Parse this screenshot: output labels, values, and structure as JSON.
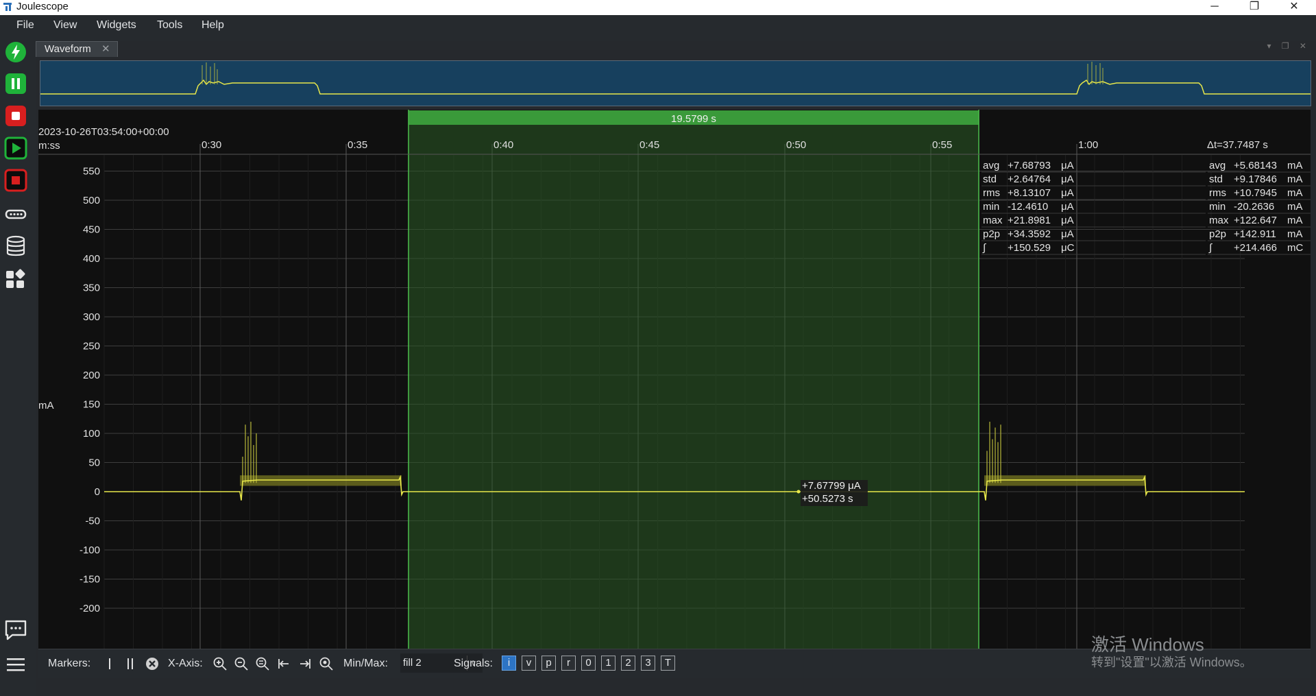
{
  "window": {
    "title": "Joulescope",
    "minimize": "─",
    "maximize": "❐",
    "close": "✕"
  },
  "menu": [
    "File",
    "View",
    "Widgets",
    "Tools",
    "Help"
  ],
  "sidebar_icons": [
    "lightning-icon",
    "pause-icon",
    "stop-icon",
    "play-icon",
    "record-stop-icon",
    "device-icon",
    "database-icon",
    "widgets-icon",
    "chat-icon",
    "menu-icon"
  ],
  "tab": {
    "label": "Waveform",
    "close": "✕"
  },
  "plot": {
    "timestamp": "2023-10-26T03:54:00+00:00",
    "x_format": "m:ss",
    "x_ticks": [
      "0:30",
      "0:35",
      "0:40",
      "0:45",
      "0:50",
      "0:55",
      "1:00"
    ],
    "y_label": "mA",
    "y_ticks": [
      "550",
      "500",
      "450",
      "400",
      "350",
      "300",
      "250",
      "200",
      "150",
      "100",
      "50",
      "0",
      "-50",
      "-100",
      "-150",
      "-200"
    ],
    "delta_t": "Δt=37.7487 s",
    "selection_width": "19.5799 s",
    "cursor_value": "+7.67799 μA",
    "cursor_time": "+50.5273 s",
    "trace_color": "#e8e84a",
    "selection_color": "#3a9a3a"
  },
  "stats_selection": [
    {
      "name": "avg",
      "value": "+7.68793",
      "unit": "μA"
    },
    {
      "name": "std",
      "value": "+2.64764",
      "unit": "μA"
    },
    {
      "name": "rms",
      "value": "+8.13107",
      "unit": "μA"
    },
    {
      "name": "min",
      "value": "-12.4610",
      "unit": "μA"
    },
    {
      "name": "max",
      "value": "+21.8981",
      "unit": "μA"
    },
    {
      "name": "p2p",
      "value": "+34.3592",
      "unit": "μA"
    },
    {
      "name": "∫",
      "value": "+150.529",
      "unit": "μC"
    }
  ],
  "stats_view": [
    {
      "name": "avg",
      "value": "+5.68143",
      "unit": "mA"
    },
    {
      "name": "std",
      "value": "+9.17846",
      "unit": "mA"
    },
    {
      "name": "rms",
      "value": "+10.7945",
      "unit": "mA"
    },
    {
      "name": "min",
      "value": "-20.2636",
      "unit": "mA"
    },
    {
      "name": "max",
      "value": "+122.647",
      "unit": "mA"
    },
    {
      "name": "p2p",
      "value": "+142.911",
      "unit": "mA"
    },
    {
      "name": "∫",
      "value": "+214.466",
      "unit": "mC"
    }
  ],
  "toolbar": {
    "markers_label": "Markers:",
    "xaxis_label": "X-Axis:",
    "minmax_label": "Min/Max:",
    "minmax_value": "fill 2",
    "signals_label": "Signals:",
    "signals": [
      "i",
      "v",
      "p",
      "r",
      "0",
      "1",
      "2",
      "3",
      "T"
    ],
    "signals_active": "i"
  },
  "watermark": {
    "line1": "激活 Windows",
    "line2": "转到\"设置\"以激活 Windows。"
  }
}
